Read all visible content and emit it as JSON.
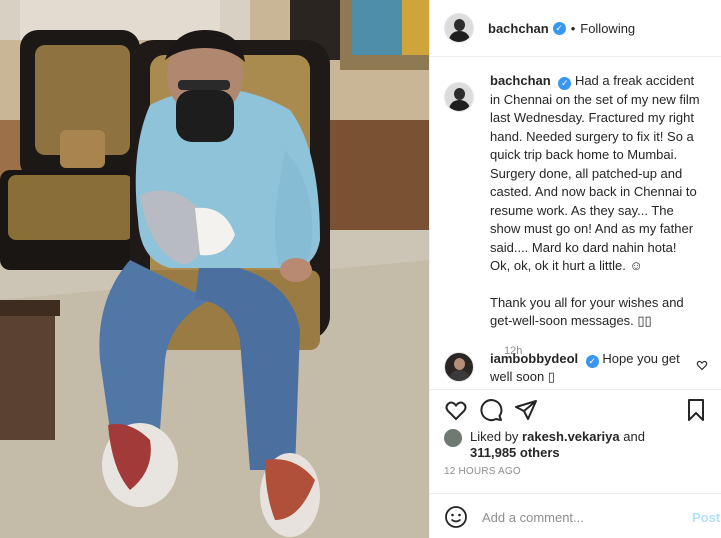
{
  "post": {
    "username": "bachchan",
    "follow_status": "Following",
    "caption_user": "bachchan",
    "caption_paragraph_1": "Had a freak accident in Chennai on the set of my new film last Wednesday. Fractured my right hand. Needed surgery to fix it! So a quick trip back home to Mumbai. Surgery done, all patched-up and casted. And now back in Chennai to resume work. As they say... The show must go on! And as my father said.... Mard ko dard nahin hota!",
    "caption_paragraph_2": "Ok, ok, ok it hurt a little. ☺",
    "caption_paragraph_3": "Thank you all for your wishes and get-well-soon messages. ▯▯",
    "caption_time": "12h"
  },
  "comment": {
    "username": "iambobbydeol",
    "text": "Hope you get well soon ▯"
  },
  "likes": {
    "prefix": "Liked by",
    "user": "rakesh.vekariya",
    "joiner": "and",
    "count": "311,985 others"
  },
  "timestamp": "12 HOURS AGO",
  "add_comment": {
    "placeholder": "Add a comment...",
    "post_label": "Post"
  },
  "icons": [
    "heart-icon",
    "comment-icon",
    "share-icon",
    "bookmark-icon",
    "emoji-icon",
    "verified-icon"
  ],
  "colors": {
    "verified": "#3897f0",
    "muted": "#8e8e8e",
    "post_disabled": "#b2dffc"
  }
}
